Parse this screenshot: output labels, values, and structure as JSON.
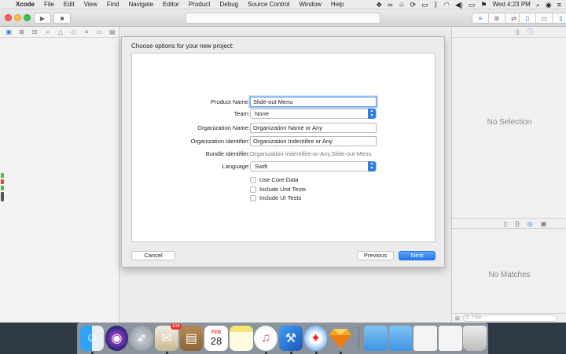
{
  "menubar": {
    "app_name": "Xcode",
    "items": [
      "File",
      "Edit",
      "View",
      "Find",
      "Navigate",
      "Editor",
      "Product",
      "Debug",
      "Source Control",
      "Window",
      "Help"
    ],
    "clock": "Wed 4:23 PM"
  },
  "dialog": {
    "title": "Choose options for your new project:",
    "fields": {
      "product_name": {
        "label": "Product Name:",
        "value": "Slide-out Menu"
      },
      "team": {
        "label": "Team:",
        "value": "None"
      },
      "organization_name": {
        "label": "Organization Name:",
        "value": "Organization Name or Any"
      },
      "organization_identifier": {
        "label": "Organization Identifier:",
        "value": "Organization Indentifire or Any"
      },
      "bundle_identifier": {
        "label": "Bundle Identifier:",
        "value": "Organization-indentifire-or-Any.Slide-out-Menu"
      },
      "language": {
        "label": "Language:",
        "value": "Swift"
      }
    },
    "checkboxes": {
      "core_data": {
        "label": "Use Core Data",
        "checked": false
      },
      "unit_tests": {
        "label": "Include Unit Tests",
        "checked": false
      },
      "ui_tests": {
        "label": "Include UI Tests",
        "checked": false
      }
    },
    "buttons": {
      "cancel": "Cancel",
      "previous": "Previous",
      "next": "Next"
    }
  },
  "utilities": {
    "inspector_empty": "No Selection",
    "library_empty": "No Matches",
    "filter_placeholder": "Filter"
  },
  "dock": {
    "mail_badge": "104",
    "calendar_month": "FEB",
    "calendar_day": "28"
  },
  "colors": {
    "accent": "#2f7de1",
    "close": "#fc605b",
    "minimize": "#fdbc40",
    "zoom": "#34c84a"
  }
}
